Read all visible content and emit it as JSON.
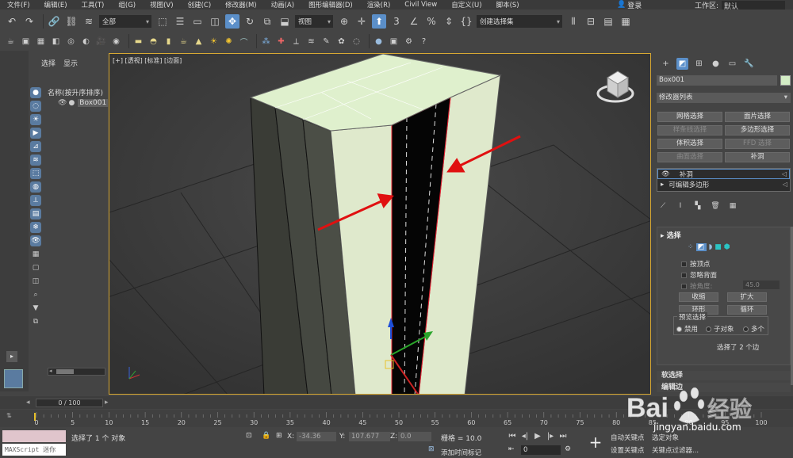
{
  "menu": [
    "文件(F)",
    "编辑(E)",
    "工具(T)",
    "组(G)",
    "视图(V)",
    "创建(C)",
    "修改器(M)",
    "动画(A)",
    "图形编辑器(D)",
    "渲染(R)",
    "Civil View",
    "自定义(U)",
    "脚本(S)"
  ],
  "login": "登录",
  "workspace": {
    "label": "工作区:",
    "value": "默认"
  },
  "toolbar": {
    "filter": "全部",
    "coord": "视图",
    "selection_set": "创建选择集"
  },
  "explorer": {
    "tab_select": "选择",
    "tab_display": "显示",
    "header": "名称(按升序排序)",
    "object": "Box001"
  },
  "viewport": {
    "label": "[+] [透视] [标准] [边面]"
  },
  "cmd_panel": {
    "object_name": "Box001",
    "object_color": "#d3ecc5",
    "modifier_list": "修改器列表",
    "buttons": [
      {
        "label": "网格选择",
        "enabled": true
      },
      {
        "label": "面片选择",
        "enabled": true
      },
      {
        "label": "样条线选择",
        "enabled": false
      },
      {
        "label": "多边形选择",
        "enabled": true
      },
      {
        "label": "体积选择",
        "enabled": true
      },
      {
        "label": "FFD 选择",
        "enabled": false
      },
      {
        "label": "曲面选择",
        "enabled": false
      },
      {
        "label": "补洞",
        "enabled": true
      }
    ],
    "stack": [
      "补洞",
      "可编辑多边形"
    ],
    "rollout": {
      "title": "选择",
      "by_vertex": "按顶点",
      "ignore_backface": "忽略背面",
      "by_angle": "按角度:",
      "angle_value": "45.0",
      "shrink": "收缩",
      "grow": "扩大",
      "ring": "环形",
      "loop": "循环",
      "preview": "预览选择",
      "disable": "禁用",
      "subobject": "子对象",
      "multiple": "多个",
      "info": "选择了 2 个边"
    },
    "collapsed": [
      "软选择",
      "编辑边"
    ]
  },
  "timeline": {
    "slider": "0 / 100",
    "ticks": [
      "0",
      "5",
      "10",
      "15",
      "20",
      "25",
      "30",
      "35",
      "40",
      "45",
      "50",
      "55",
      "60",
      "65",
      "70",
      "75",
      "80",
      "85",
      "90",
      "95",
      "100"
    ]
  },
  "status": {
    "maxscript": "MAXScript 迷你",
    "selected": "选择了 1 个 对象",
    "x_label": "X:",
    "x_value": "-34.36",
    "y_label": "Y:",
    "y_value": "107.677",
    "z_label": "Z:",
    "z_value": "0.0",
    "grid": "栅格 = 10.0",
    "add_time_tag": "添加时间标记",
    "auto_key": "自动关键点",
    "selected_obj": "选定对象",
    "set_key": "设置关键点",
    "key_filter": "关键点过滤器...",
    "frame": "0"
  },
  "watermark": {
    "text": "Bai 经验",
    "url": "jingyan.baidu.com"
  }
}
